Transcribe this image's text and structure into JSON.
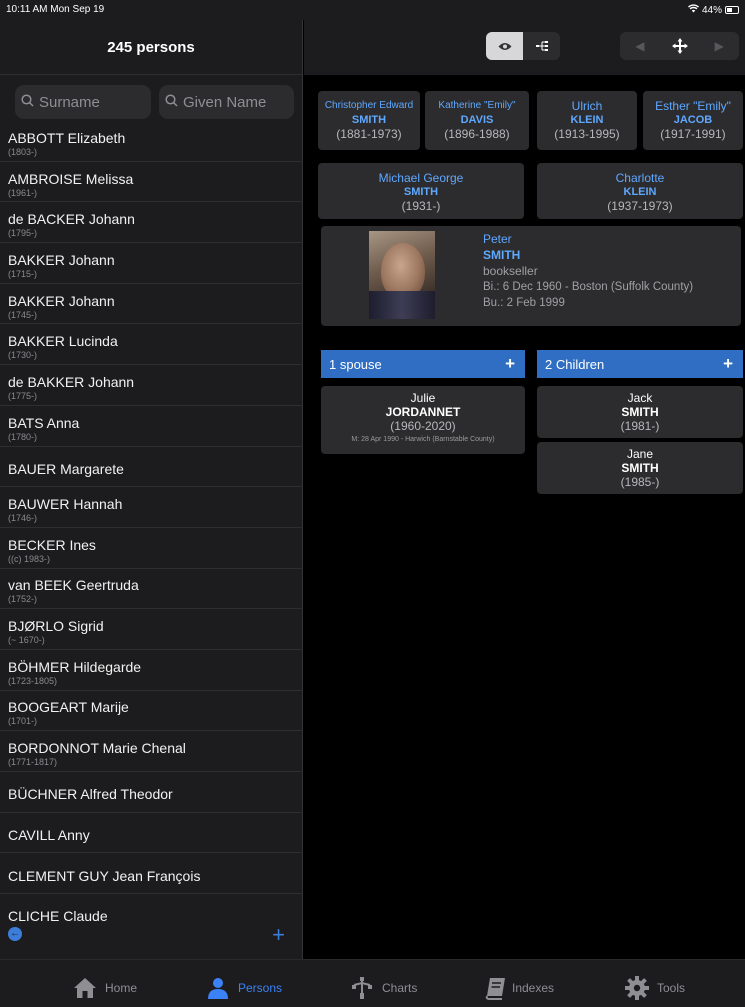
{
  "status": {
    "time": "10:11 AM  Mon Sep 19",
    "battery": "44%",
    "wifi_icon": "wifi-icon"
  },
  "sidebar": {
    "title": "245 persons",
    "search_surname_placeholder": "Surname",
    "search_given_placeholder": "Given Name",
    "persons": [
      {
        "name": "ABBOTT Elizabeth",
        "dates": "(1803-)"
      },
      {
        "name": "AMBROISE Melissa",
        "dates": "(1961-)"
      },
      {
        "name": "de BACKER Johann",
        "dates": "(1795-)"
      },
      {
        "name": "BAKKER Johann",
        "dates": "(1715-)"
      },
      {
        "name": "BAKKER Johann",
        "dates": "(1745-)"
      },
      {
        "name": "BAKKER Lucinda",
        "dates": "(1730-)"
      },
      {
        "name": "de BAKKER Johann",
        "dates": "(1775-)"
      },
      {
        "name": "BATS Anna",
        "dates": "(1780-)"
      },
      {
        "name": "BAUER Margarete",
        "dates": ""
      },
      {
        "name": "BAUWER Hannah",
        "dates": "(1746-)"
      },
      {
        "name": "BECKER Ines",
        "dates": "((c) 1983-)"
      },
      {
        "name": "van BEEK Geertruda",
        "dates": "(1752-)"
      },
      {
        "name": "BJØRLO Sigrid",
        "dates": "(~ 1670-)"
      },
      {
        "name": "BÖHMER Hildegarde",
        "dates": "(1723-1805)"
      },
      {
        "name": "BOOGEART Marije",
        "dates": "(1701-)"
      },
      {
        "name": "BORDONNOT Marie Chenal",
        "dates": "(1771-1817)"
      },
      {
        "name": "BÜCHNER Alfred Theodor",
        "dates": ""
      },
      {
        "name": "CAVILL Anny",
        "dates": ""
      },
      {
        "name": "CLEMENT GUY Jean François",
        "dates": ""
      },
      {
        "name": "CLICHE Claude",
        "dates": ""
      }
    ],
    "add_label": "+"
  },
  "grandparents": [
    {
      "given": "Christopher Edward",
      "surname": "SMITH",
      "years": "(1881-1973)"
    },
    {
      "given": "Katherine \"Emily\"",
      "surname": "DAVIS",
      "years": "(1896-1988)"
    },
    {
      "given": "Ulrich",
      "surname": "KLEIN",
      "years": "(1913-1995)"
    },
    {
      "given": "Esther \"Emily\"",
      "surname": "JACOB",
      "years": "(1917-1991)"
    }
  ],
  "parents": [
    {
      "given": "Michael George",
      "surname": "SMITH",
      "years": "(1931-)"
    },
    {
      "given": "Charlotte",
      "surname": "KLEIN",
      "years": "(1937-1973)"
    }
  ],
  "main_person": {
    "given": "Peter",
    "surname": "SMITH",
    "occupation": "bookseller",
    "birth": "Bi.: 6 Dec 1960 - Boston (Suffolk County)",
    "burial": "Bu.: 2 Feb 1999"
  },
  "spouses": {
    "header": "1 spouse",
    "items": [
      {
        "given": "Julie",
        "surname": "JORDANNET",
        "years": "(1960-2020)",
        "marriage": "M: 28 Apr 1990 - Harwich (Barnstable County)"
      }
    ]
  },
  "children": {
    "header": "2 Children",
    "items": [
      {
        "given": "Jack",
        "surname": "SMITH",
        "years": "(1981-)"
      },
      {
        "given": "Jane",
        "surname": "SMITH",
        "years": "(1985-)"
      }
    ]
  },
  "tabs": [
    {
      "label": "Home",
      "icon": "house-icon",
      "active": false
    },
    {
      "label": "Persons",
      "icon": "person-icon",
      "active": true
    },
    {
      "label": "Charts",
      "icon": "tree-icon",
      "active": false
    },
    {
      "label": "Indexes",
      "icon": "book-icon",
      "active": false
    },
    {
      "label": "Tools",
      "icon": "gear-icon",
      "active": false
    }
  ],
  "colors": {
    "accent": "#3b82f6",
    "name_blue": "#5fa8ff",
    "section_bar": "#2f6ec3",
    "card_bg": "#2c2c2e"
  }
}
